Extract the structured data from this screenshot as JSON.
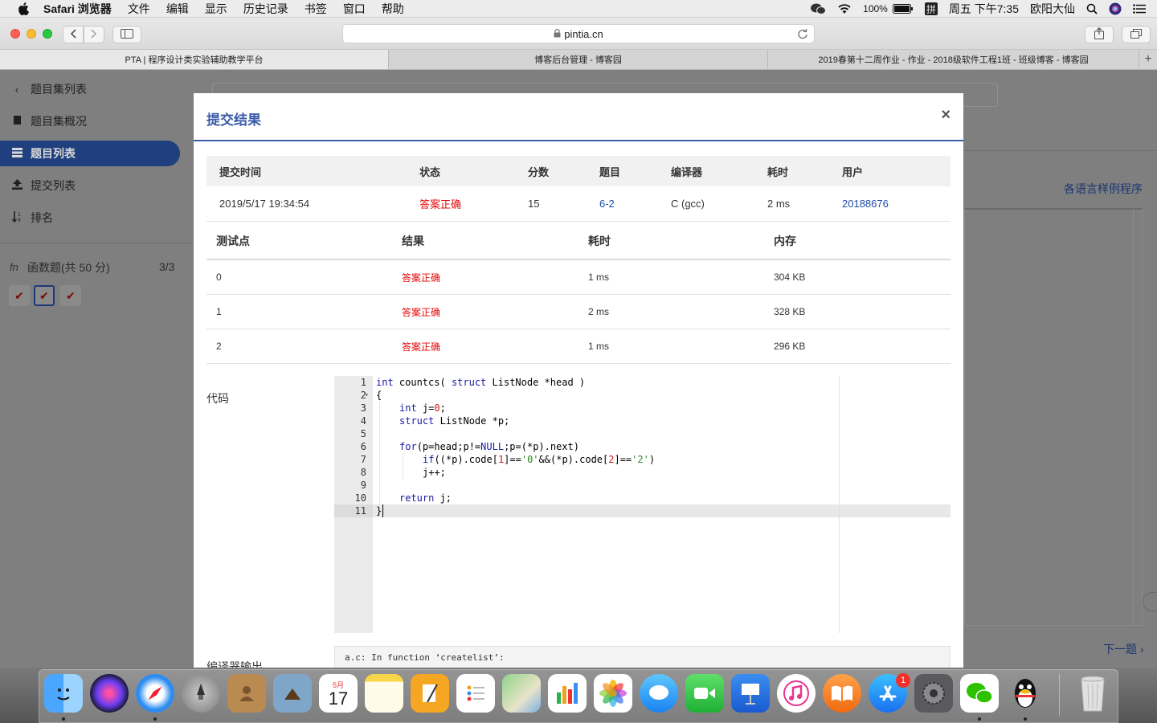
{
  "menubar": {
    "app_name": "Safari 浏览器",
    "items": [
      "文件",
      "编辑",
      "显示",
      "历史记录",
      "书签",
      "窗口",
      "帮助"
    ],
    "battery": "100%",
    "input_method": "拼",
    "clock": "周五 下午7:35",
    "user": "欧阳大仙"
  },
  "browser": {
    "url": "pintia.cn",
    "tabs": [
      "PTA | 程序设计类实验辅助教学平台",
      "博客后台管理 - 博客园",
      "2019春第十二周作业 - 作业 - 2018级软件工程1班 - 班级博客 - 博客园"
    ],
    "new_tab": "+"
  },
  "sidebar": {
    "back_label": "题目集列表",
    "overview_label": "题目集概况",
    "problems_label": "题目列表",
    "submissions_label": "提交列表",
    "ranking_label": "排名",
    "section_icon_text": "fn",
    "section_title": "函数题(共 50 分)",
    "section_score": "3/3",
    "check_mark": "✔"
  },
  "background": {
    "sample_link": "各语言样例程序",
    "next_link": "下一题"
  },
  "modal": {
    "title": "提交结果",
    "close": "×",
    "summary_headers": {
      "time": "提交时间",
      "status": "状态",
      "score": "分数",
      "problem": "题目",
      "compiler": "编译器",
      "duration": "耗时",
      "user": "用户"
    },
    "summary": {
      "time": "2019/5/17 19:34:54",
      "status": "答案正确",
      "score": "15",
      "problem": "6-2",
      "compiler": "C (gcc)",
      "duration": "2 ms",
      "user": "20188676"
    },
    "test_headers": {
      "case": "测试点",
      "result": "结果",
      "duration": "耗时",
      "memory": "内存"
    },
    "tests": [
      {
        "case": "0",
        "result": "答案正确",
        "duration": "1 ms",
        "memory": "304 KB"
      },
      {
        "case": "1",
        "result": "答案正确",
        "duration": "2 ms",
        "memory": "328 KB"
      },
      {
        "case": "2",
        "result": "答案正确",
        "duration": "1 ms",
        "memory": "296 KB"
      }
    ],
    "code_label": "代码",
    "compiler_output_label": "编译器输出",
    "compiler_output": "a.c: In function ‘createlist’:"
  },
  "code": {
    "line_numbers": [
      "1",
      "2",
      "3",
      "4",
      "5",
      "6",
      "7",
      "8",
      "9",
      "10",
      "11"
    ],
    "fold_marker": "▾",
    "l1": {
      "a": "int",
      "b": " countcs( ",
      "c": "struct",
      "d": " ListNode *head )"
    },
    "l2": "{",
    "l3": {
      "a": "int",
      "b": " j=",
      "c": "0",
      "d": ";"
    },
    "l4": {
      "a": "struct",
      "b": " ListNode *p;"
    },
    "l6": {
      "a": "for",
      "b": "(p=head;p!=",
      "c": "NULL",
      "d": ";p=(*p).next)"
    },
    "l7": {
      "a": "if",
      "b": "((*p).code[",
      "c": "1",
      "d": "]==",
      "e": "'0'",
      "f": "&&(*p).code[",
      "g": "2",
      "h": "]==",
      "i": "'2'",
      "j": ")"
    },
    "l8": "j++;",
    "l10": {
      "a": "return",
      "b": " j;"
    },
    "l11": "}"
  },
  "dock": {
    "calendar_month": "5月",
    "calendar_day": "17",
    "appstore_badge": "1",
    "apps": [
      "finder-icon",
      "siri-icon",
      "safari-icon",
      "launchpad-icon",
      "contacts-icon",
      "preview-icon",
      "calendar-icon",
      "notes-icon",
      "pages-icon",
      "reminders-icon",
      "maps-icon",
      "numbers-icon",
      "photos-icon",
      "messages-icon",
      "facetime-icon",
      "keynote-icon",
      "itunes-icon",
      "books-icon",
      "appstore-icon",
      "system-preferences-icon",
      "wechat-icon",
      "qq-icon",
      "trash-icon"
    ]
  }
}
